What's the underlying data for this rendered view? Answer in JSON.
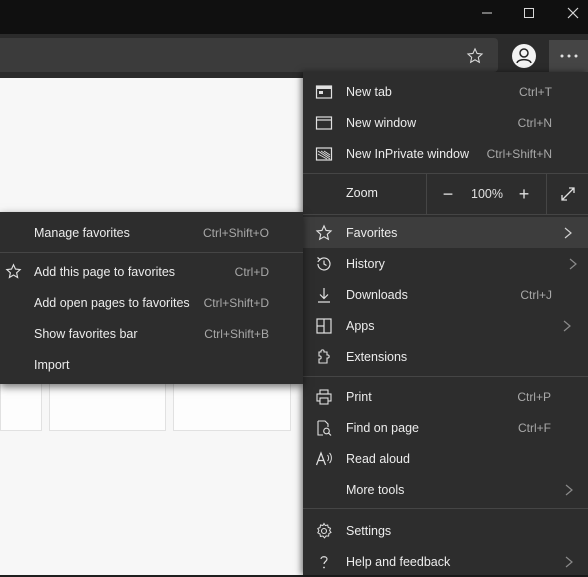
{
  "menu": {
    "items_top": [
      {
        "label": "New tab",
        "shortcut": "Ctrl+T",
        "icon": "new-tab-icon"
      },
      {
        "label": "New window",
        "shortcut": "Ctrl+N",
        "icon": "new-window-icon"
      },
      {
        "label": "New InPrivate window",
        "shortcut": "Ctrl+Shift+N",
        "icon": "inprivate-icon"
      }
    ],
    "zoom": {
      "label": "Zoom",
      "value": "100%",
      "minus": "−",
      "plus": "+"
    },
    "items_mid": [
      {
        "label": "Favorites",
        "shortcut": "",
        "icon": "star-icon",
        "has_submenu": true
      },
      {
        "label": "History",
        "shortcut": "",
        "icon": "history-icon",
        "has_submenu": true
      },
      {
        "label": "Downloads",
        "shortcut": "Ctrl+J",
        "icon": "download-icon"
      },
      {
        "label": "Apps",
        "shortcut": "",
        "icon": "apps-icon",
        "has_submenu": true
      },
      {
        "label": "Extensions",
        "shortcut": "",
        "icon": "extensions-icon"
      }
    ],
    "items_bottom": [
      {
        "label": "Print",
        "shortcut": "Ctrl+P",
        "icon": "print-icon"
      },
      {
        "label": "Find on page",
        "shortcut": "Ctrl+F",
        "icon": "find-icon"
      },
      {
        "label": "Read aloud",
        "shortcut": "",
        "icon": "read-aloud-icon"
      },
      {
        "label": "More tools",
        "shortcut": "",
        "icon": "",
        "has_submenu": true
      }
    ],
    "items_footer": [
      {
        "label": "Settings",
        "shortcut": "",
        "icon": "settings-icon"
      },
      {
        "label": "Help and feedback",
        "shortcut": "",
        "icon": "help-icon",
        "has_submenu": true
      }
    ]
  },
  "favorites_submenu": {
    "items": [
      {
        "label": "Manage favorites",
        "shortcut": "Ctrl+Shift+O"
      },
      {
        "label": "Add this page to favorites",
        "shortcut": "Ctrl+D"
      },
      {
        "label": "Add open pages to favorites",
        "shortcut": "Ctrl+Shift+D"
      },
      {
        "label": "Show favorites bar",
        "shortcut": "Ctrl+Shift+B"
      },
      {
        "label": "Import",
        "shortcut": ""
      }
    ]
  },
  "colors": {
    "menu_bg": "#2d2d2d",
    "highlight": "#3d3d3d",
    "text": "#ececec",
    "shortcut": "#a8a8a8"
  }
}
